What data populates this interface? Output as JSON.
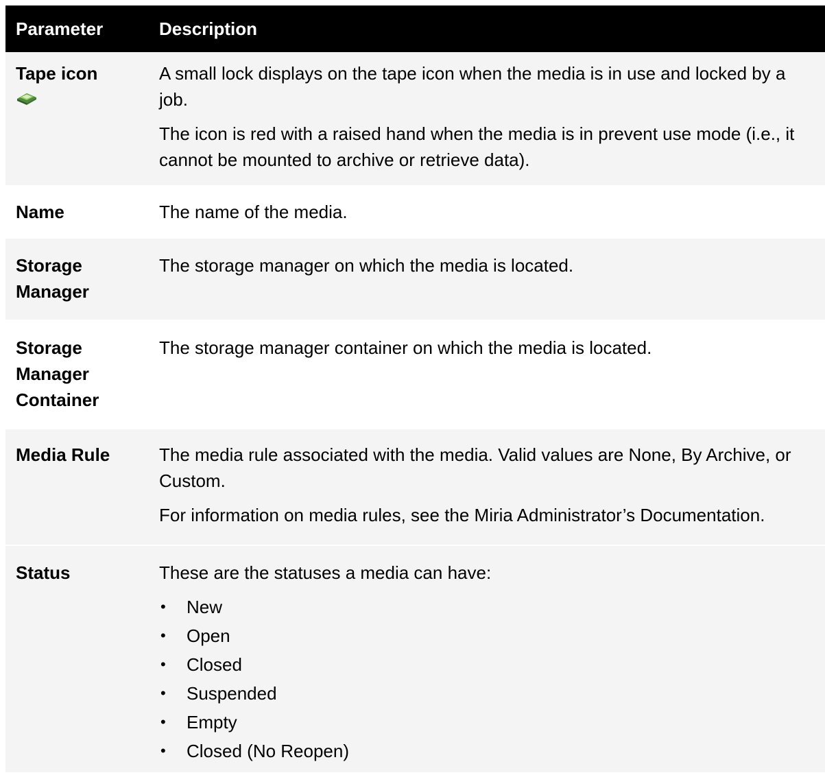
{
  "header": {
    "param": "Parameter",
    "desc": "Description"
  },
  "rows": [
    {
      "param": "Tape icon",
      "desc": [
        "A small lock displays on the tape icon when the media is in use and locked by a job.",
        "The icon is red with a raised hand when the media is in prevent use mode (i.e., it cannot be mounted to archive or retrieve data)."
      ],
      "icon": "tape-icon"
    },
    {
      "param": "Name",
      "desc": [
        "The name of the media."
      ]
    },
    {
      "param": "Storage Manager",
      "desc": [
        "The storage manager on which the media is located."
      ]
    },
    {
      "param": "Storage Manager Container",
      "desc": [
        "The storage manager container on which the media is located."
      ]
    },
    {
      "param": "Media Rule",
      "desc": [
        "The media rule associated with the media. Valid values are None, By Archive, or Custom.",
        "For information on media rules, see the Miria Administrator’s Documentation."
      ]
    },
    {
      "param": "Status",
      "desc": [
        "These are the statuses a media can have:"
      ],
      "bullets": [
        "New",
        "Open",
        "Closed",
        "Suspended",
        "Empty",
        "Closed (No Reopen)"
      ]
    }
  ],
  "colors": {
    "header_bg": "#000000",
    "shade_bg": "#f4f4f4",
    "tape_green": "#6aa84f"
  }
}
